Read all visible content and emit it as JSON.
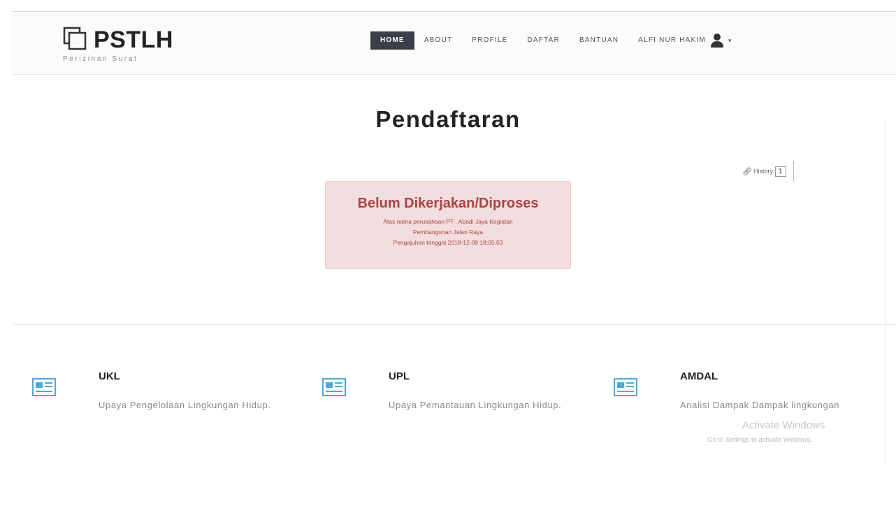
{
  "brand": {
    "title": "PSTLH",
    "subtitle": "Perizinan Surat"
  },
  "nav": {
    "items": [
      "HOME",
      "ABOUT",
      "PROFILE",
      "DAFTAR",
      "BANTUAN"
    ],
    "active": "HOME",
    "user_name": "ALFI NUR HAKIM",
    "user_icon": "user-icon",
    "caret_icon": "caret-down-icon"
  },
  "page": {
    "title": "Pendaftaran"
  },
  "history": {
    "label": "History",
    "count": "1",
    "icon": "paperclip-icon"
  },
  "status": {
    "title": "Belum Dikerjakan/Diproses",
    "line1": "Atas nama perusahaan PT . Abadi Jaya Kegiatan",
    "line2": "Pembangunan Jalan Raya",
    "line3": "Pengajuhan tanggal 2018-12-09 18:05:03",
    "colors": {
      "background": "#f2dede",
      "text": "#a94442"
    }
  },
  "features": [
    {
      "title": "UKL",
      "desc": "Upaya Pengelolaan Lingkungan Hidup.",
      "icon": "newspaper-icon"
    },
    {
      "title": "UPL",
      "desc": "Upaya Pemantauan Lingkungan Hidup.",
      "icon": "newspaper-icon"
    },
    {
      "title": "AMDAL",
      "desc": "Analisi Dampak Dampak lingkungan",
      "icon": "newspaper-icon"
    }
  ],
  "watermark": {
    "line1": "Activate Windows",
    "line2": "Go to Settings to activate Windows."
  },
  "colors": {
    "accent_icon": "#4fa8d8",
    "nav_active_bg": "#3b3f47"
  }
}
